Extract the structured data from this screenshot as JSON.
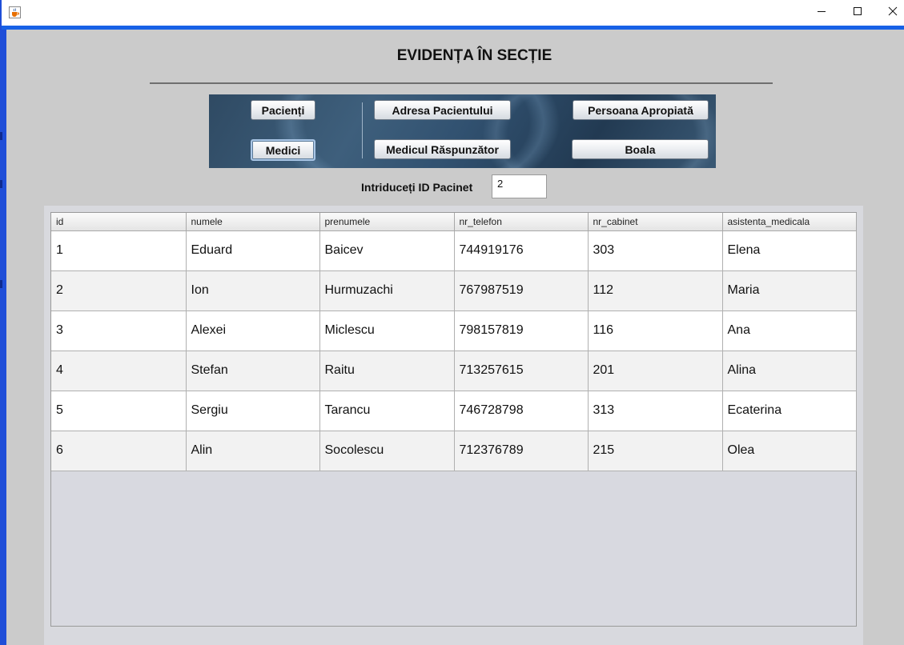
{
  "window": {
    "title": "",
    "icon": "java-cup-icon",
    "controls": [
      "minimize-icon",
      "maximize-icon",
      "close-icon"
    ]
  },
  "header": {
    "title": "EVIDENȚA ÎN SECȚIE"
  },
  "buttons": {
    "pacienti": "Pacienți",
    "medici": "Medici",
    "adresa": "Adresa Pacientului",
    "medic_raspunzator": "Medicul Răspunzător",
    "persoana": "Persoana Apropiată",
    "boala": "Boala",
    "focused": "medici"
  },
  "search": {
    "label": "Intriduceți ID Pacinet",
    "value": "2"
  },
  "table": {
    "columns": [
      "id",
      "numele",
      "prenumele",
      "nr_telefon",
      "nr_cabinet",
      "asistenta_medicala"
    ],
    "rows": [
      [
        "1",
        "Eduard",
        "Baicev",
        "744919176",
        "303",
        "Elena"
      ],
      [
        "2",
        "Ion",
        "Hurmuzachi",
        "767987519",
        "112",
        "Maria"
      ],
      [
        "3",
        "Alexei",
        "Miclescu",
        "798157819",
        "116",
        "Ana"
      ],
      [
        "4",
        "Stefan",
        "Raitu",
        "713257615",
        "201",
        "Alina"
      ],
      [
        "5",
        "Sergiu",
        "Tarancu",
        "746728798",
        "313",
        "Ecaterina"
      ],
      [
        "6",
        "Alin",
        "Socolescu",
        "712376789",
        "215",
        "Olea"
      ]
    ]
  },
  "colors": {
    "accent_bar": "#1761e6",
    "panel_background": "#2f4a63",
    "window_background": "#cbcbcb"
  }
}
